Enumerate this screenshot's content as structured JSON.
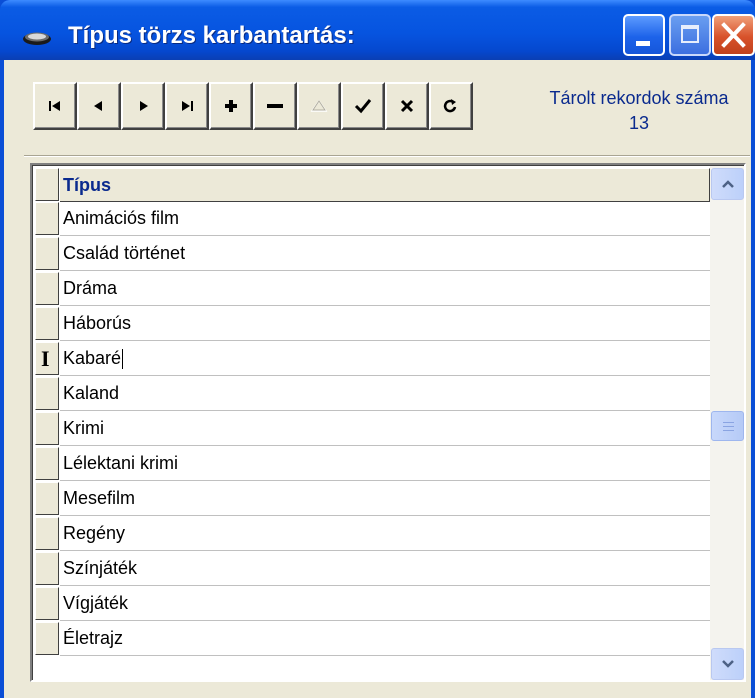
{
  "window": {
    "title": "Típus törzs karbantartás:",
    "icon": "book-icon",
    "controls": [
      "minimize-icon",
      "maximize-icon",
      "close-icon"
    ]
  },
  "navigator": {
    "buttons": [
      {
        "name": "first",
        "icon": "first-record-icon",
        "enabled": true
      },
      {
        "name": "prior",
        "icon": "prior-record-icon",
        "enabled": true
      },
      {
        "name": "next",
        "icon": "next-record-icon",
        "enabled": true
      },
      {
        "name": "last",
        "icon": "last-record-icon",
        "enabled": true
      },
      {
        "name": "insert",
        "icon": "plus-icon",
        "enabled": true
      },
      {
        "name": "delete",
        "icon": "minus-icon",
        "enabled": true
      },
      {
        "name": "edit",
        "icon": "triangle-up-icon",
        "enabled": false
      },
      {
        "name": "post",
        "icon": "checkmark-icon",
        "enabled": true
      },
      {
        "name": "cancel",
        "icon": "x-icon",
        "enabled": true
      },
      {
        "name": "refresh",
        "icon": "refresh-icon",
        "enabled": true
      }
    ]
  },
  "records": {
    "label": "Tárolt rekordok száma",
    "count": "13"
  },
  "grid": {
    "column_header": "Típus",
    "rows": [
      "Animációs film",
      "Család történet",
      "Dráma",
      "Háborús",
      "Kabaré",
      "Kaland",
      "Krimi",
      "Lélektani krimi",
      "Mesefilm",
      "Regény",
      "Színjáték",
      "Vígjáték",
      "Életrajz"
    ],
    "active_row": 4
  },
  "colors": {
    "titlebar": "#0654e0",
    "label_blue": "#0a2a8e",
    "face": "#ece9d8"
  }
}
